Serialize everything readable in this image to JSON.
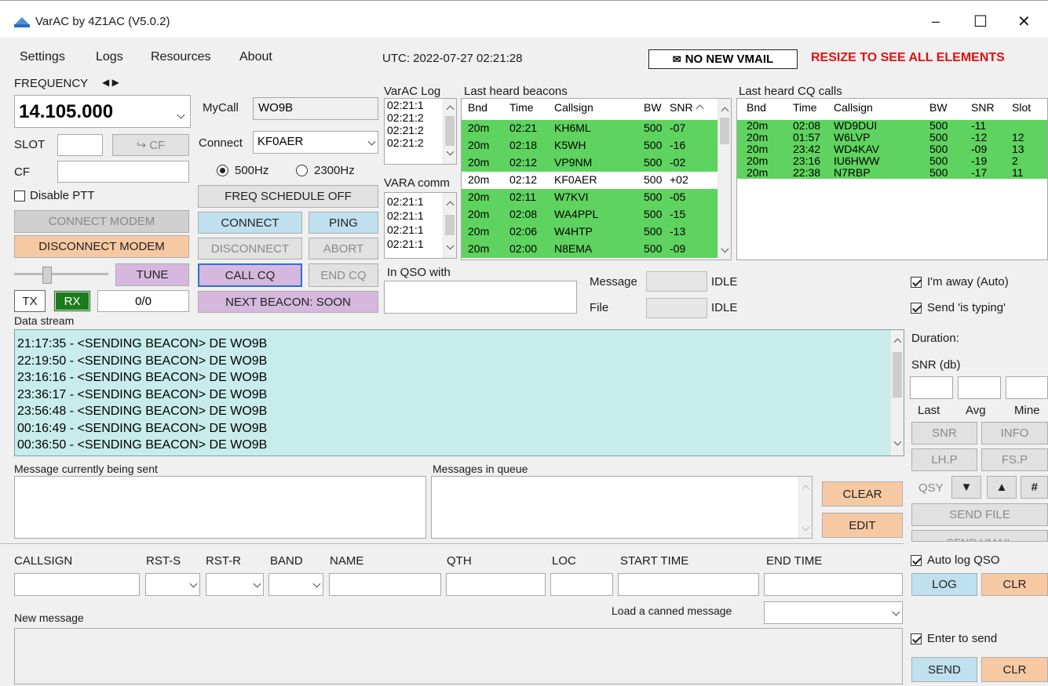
{
  "window": {
    "title": "VarAC by 4Z1AC (V5.0.2)",
    "minimize": "–",
    "maximize": "☐",
    "close": "✕"
  },
  "menu": [
    "Settings",
    "Logs",
    "Resources",
    "About"
  ],
  "utc": "UTC: 2022-07-27 02:21:28",
  "vmail": "NO NEW VMAIL",
  "resize_notice": "RESIZE TO SEE ALL ELEMENTS",
  "left": {
    "frequency_label": "FREQUENCY",
    "frequency_value": "14.105.000",
    "slot_label": "SLOT",
    "cf_button": "CF",
    "cf_label": "CF",
    "disable_ptt": "Disable PTT",
    "connect_modem": "CONNECT MODEM",
    "disconnect_modem": "DISCONNECT MODEM",
    "tune": "TUNE",
    "tx": "TX",
    "rx": "RX",
    "counter": "0/0"
  },
  "mid": {
    "mycall_label": "MyCall",
    "mycall": "WO9B",
    "connect_label": "Connect",
    "connect_value": "KF0AER",
    "bw_500": "500Hz",
    "bw_2300": "2300Hz",
    "freq_schedule": "FREQ SCHEDULE OFF",
    "connect": "CONNECT",
    "ping": "PING",
    "disconnect": "DISCONNECT",
    "abort": "ABORT",
    "call_cq": "CALL CQ",
    "end_cq": "END CQ",
    "next_beacon": "NEXT BEACON: SOON"
  },
  "varac_log": {
    "label": "VarAC Log",
    "items": [
      "02:21:1",
      "02:21:2",
      "02:21:2",
      "02:21:2"
    ]
  },
  "vara_comm": {
    "label": "VARA comm",
    "items": [
      "02:21:1",
      "02:21:1",
      "02:21:1",
      "02:21:1"
    ]
  },
  "beacons": {
    "label": "Last heard beacons",
    "headers": [
      "Bnd",
      "Time",
      "Callsign",
      "BW",
      "SNR"
    ],
    "rows": [
      [
        "20m",
        "02:21",
        "KH6ML",
        "500",
        "-07"
      ],
      [
        "20m",
        "02:18",
        "K5WH",
        "500",
        "-16"
      ],
      [
        "20m",
        "02:12",
        "VP9NM",
        "500",
        "-02"
      ],
      [
        "20m",
        "02:12",
        "KF0AER",
        "500",
        "+02"
      ],
      [
        "20m",
        "02:11",
        "W7KVI",
        "500",
        "-05"
      ],
      [
        "20m",
        "02:08",
        "WA4PPL",
        "500",
        "-15"
      ],
      [
        "20m",
        "02:06",
        "W4HTP",
        "500",
        "-13"
      ],
      [
        "20m",
        "02:00",
        "N8EMA",
        "500",
        "-09"
      ]
    ],
    "highlight_colors": [
      "#5fd35f",
      "#5fd35f",
      "#5fd35f",
      "#ffffff",
      "#5fd35f",
      "#5fd35f",
      "#5fd35f",
      "#5fd35f"
    ]
  },
  "cq": {
    "label": "Last heard CQ calls",
    "headers": [
      "Bnd",
      "Time",
      "Callsign",
      "BW",
      "SNR",
      "Slot"
    ],
    "rows": [
      [
        "20m",
        "02:08",
        "WD9DUI",
        "500",
        "-11",
        ""
      ],
      [
        "20m",
        "01:57",
        "W6LVP",
        "500",
        "-12",
        "12"
      ],
      [
        "20m",
        "23:42",
        "WD4KAV",
        "500",
        "-09",
        "13"
      ],
      [
        "20m",
        "23:16",
        "IU6HWW",
        "500",
        "-19",
        "2"
      ],
      [
        "20m",
        "22:38",
        "N7RBP",
        "500",
        "-17",
        "11"
      ]
    ]
  },
  "qso": {
    "in_qso_label": "In QSO with",
    "message_label": "Message",
    "file_label": "File",
    "idle": "IDLE"
  },
  "right": {
    "away": "I'm away (Auto)",
    "typing": "Send 'is typing'",
    "duration": "Duration:",
    "snr_db": "SNR (db)",
    "last": "Last",
    "avg": "Avg",
    "mine": "Mine",
    "snr": "SNR",
    "info": "INFO",
    "lhp": "LH.P",
    "fsp": "FS.P",
    "qsy": "QSY",
    "hash": "#",
    "send_file": "SEND FILE",
    "send_vmail": "SEND VMAIL",
    "auto_log": "Auto log QSO",
    "log": "LOG",
    "clr": "CLR",
    "enter_to_send": "Enter to send",
    "send": "SEND",
    "clr2": "CLR"
  },
  "stream": {
    "label": "Data stream",
    "lines": [
      "21:17:35 - <SENDING BEACON> DE WO9B",
      "22:19:50 - <SENDING BEACON> DE WO9B",
      "23:16:16 - <SENDING BEACON> DE WO9B",
      "23:36:17 - <SENDING BEACON> DE WO9B",
      "23:56:48 - <SENDING BEACON> DE WO9B",
      "00:16:49 - <SENDING BEACON> DE WO9B",
      "00:36:50 - <SENDING BEACON> DE WO9B"
    ]
  },
  "queue": {
    "current_label": "Message currently being sent",
    "queue_label": "Messages in queue",
    "clear": "CLEAR",
    "edit": "EDIT"
  },
  "log_fields": {
    "labels": [
      "CALLSIGN",
      "RST-S",
      "RST-R",
      "BAND",
      "NAME",
      "QTH",
      "LOC",
      "START TIME",
      "END TIME"
    ]
  },
  "new_message": {
    "label": "New message",
    "canned_label": "Load a canned message"
  },
  "colors": {
    "green": "#5fd35f",
    "cyan": "#c8ecec",
    "orange": "#f7c9a3",
    "purple": "#d6b8de",
    "blue_btn": "#bfe0ee",
    "red": "#e01010"
  }
}
